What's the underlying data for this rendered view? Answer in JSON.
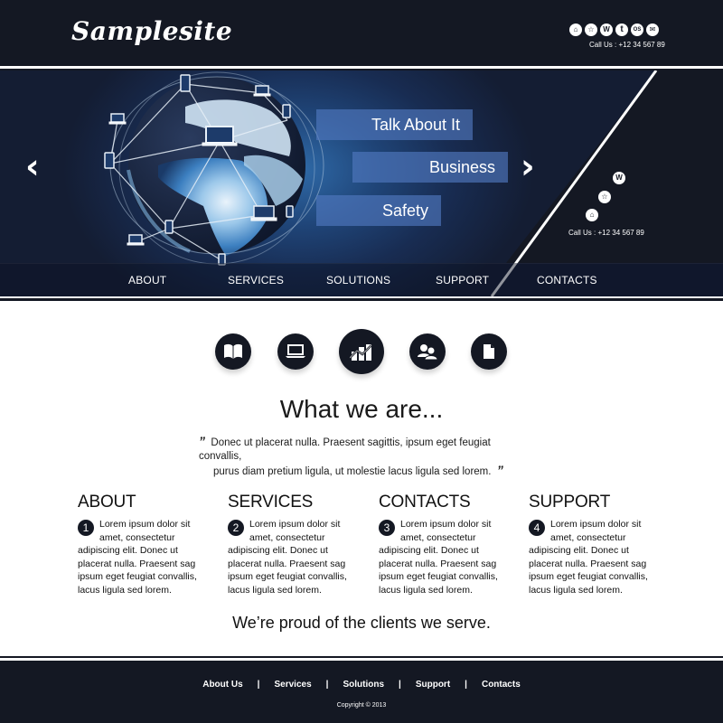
{
  "header": {
    "logo": "Samplesite",
    "social_icons": [
      {
        "name": "home-icon",
        "glyph": "⌂"
      },
      {
        "name": "star-icon",
        "glyph": "☆"
      },
      {
        "name": "wordpress-icon",
        "glyph": "W"
      },
      {
        "name": "tumblr-icon",
        "glyph": "t"
      },
      {
        "name": "os-icon",
        "glyph": "OS"
      },
      {
        "name": "mail-icon",
        "glyph": "✉"
      }
    ],
    "call_us": "Call Us : +12 34 567 89"
  },
  "hero": {
    "banners": [
      "Talk About It",
      "Business",
      "Safety"
    ],
    "prev_glyph": "‹",
    "next_glyph": "›",
    "diag_social": [
      {
        "name": "wordpress-icon",
        "glyph": "W"
      },
      {
        "name": "star-icon",
        "glyph": "☆"
      },
      {
        "name": "home-icon",
        "glyph": "⌂"
      }
    ],
    "call_us": "Call Us : +12 34 567 89"
  },
  "nav": {
    "items": [
      "ABOUT",
      "SERVICES",
      "SOLUTIONS",
      "SUPPORT",
      "CONTACTS"
    ]
  },
  "features": {
    "icons": [
      "book-icon",
      "laptop-icon",
      "chart-icon",
      "users-icon",
      "document-icon"
    ]
  },
  "intro": {
    "title": "What we are...",
    "open_quote": "”",
    "close_quote": "”",
    "line1": "Donec ut placerat nulla. Praesent sagittis, ipsum eget feugiat convallis,",
    "line2": "purus diam pretium ligula, ut molestie lacus ligula sed lorem."
  },
  "columns": [
    {
      "title": "ABOUT",
      "number": "1",
      "text": "Lorem ipsum dolor sit amet, consectetur adipiscing elit. Donec ut placerat nulla. Praesent sag ipsum eget feugiat convallis, lacus ligula sed lorem."
    },
    {
      "title": "SERVICES",
      "number": "2",
      "text": "Lorem ipsum dolor sit amet, consectetur adipiscing elit. Donec ut placerat nulla. Praesent sag ipsum eget feugiat convallis, lacus ligula sed lorem."
    },
    {
      "title": "CONTACTS",
      "number": "3",
      "text": "Lorem ipsum dolor sit amet, consectetur adipiscing elit. Donec ut placerat nulla. Praesent sag ipsum eget feugiat convallis, lacus ligula sed lorem."
    },
    {
      "title": "SUPPORT",
      "number": "4",
      "text": "Lorem ipsum dolor sit amet, consectetur adipiscing elit. Donec ut placerat nulla. Praesent sag ipsum eget feugiat convallis, lacus ligula sed lorem."
    }
  ],
  "clients": {
    "text": "We’re proud of the clients we serve."
  },
  "footer": {
    "links": [
      "About Us",
      "Services",
      "Solutions",
      "Support",
      "Contacts"
    ],
    "separator": "|",
    "copyright": "Copyright © 2013"
  },
  "colors": {
    "dark": "#141823",
    "hero_blue": "#1f4477",
    "banner": "#5078be",
    "white": "#ffffff"
  }
}
